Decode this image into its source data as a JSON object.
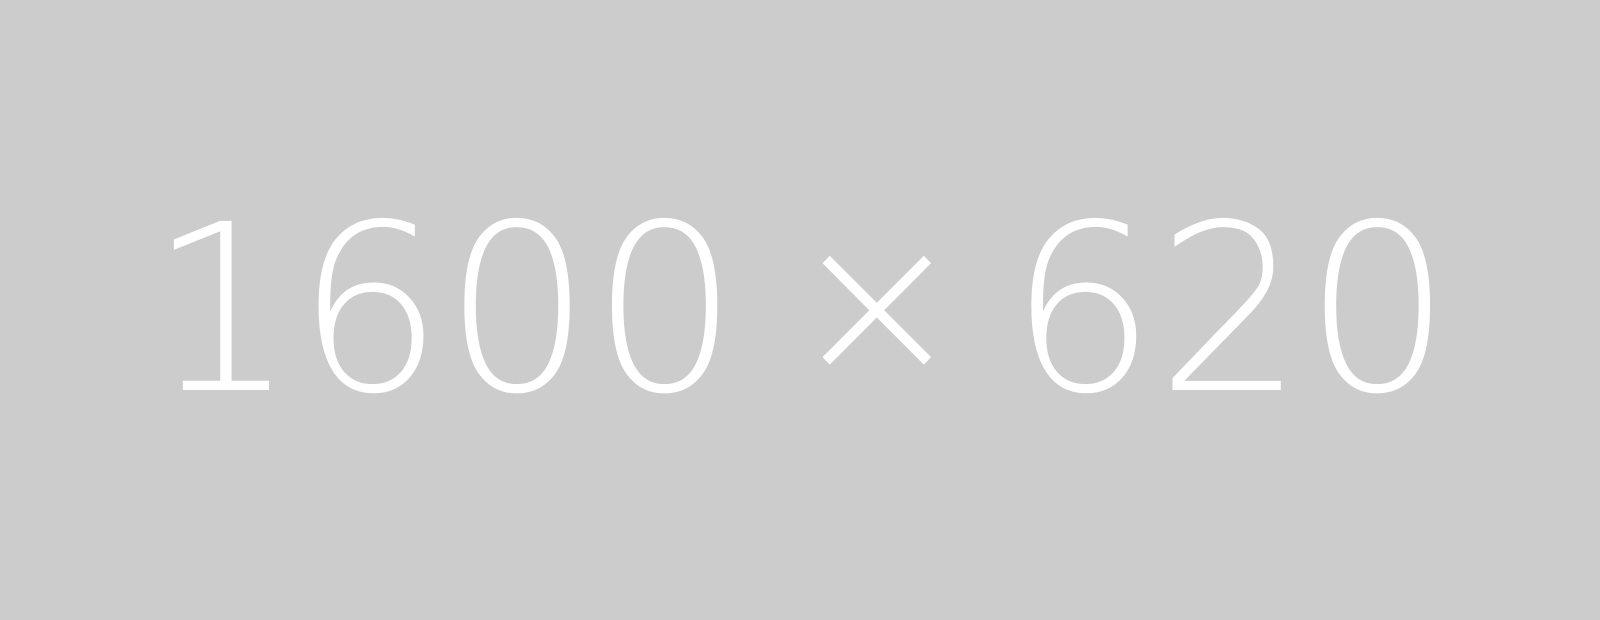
{
  "placeholder": {
    "width_text": "1600",
    "separator": "×",
    "height_text": "620",
    "background_color": "#cccccc",
    "text_color": "#ffffff"
  }
}
